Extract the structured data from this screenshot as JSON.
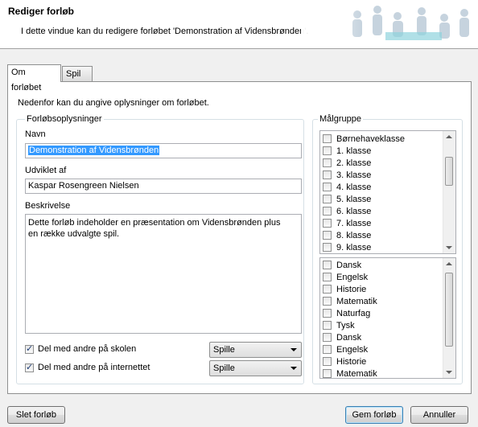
{
  "header": {
    "title": "Rediger forløb",
    "subtitle": "I dette vindue kan du redigere forløbet 'Demonstration af Vidensbrønden'."
  },
  "tabs": [
    {
      "label": "Om forløbet",
      "active": true
    },
    {
      "label": "Spil",
      "active": false
    }
  ],
  "intro": "Nedenfor kan du angive oplysninger om forløbet.",
  "details": {
    "legend": "Forløbsoplysninger",
    "name_label": "Navn",
    "name_value": "Demonstration af Vidensbrønden",
    "author_label": "Udviklet af",
    "author_value": "Kaspar Rosengreen Nielsen",
    "description_label": "Beskrivelse",
    "description_value": "Dette forløb indeholder en præsentation om Vidensbrønden plus en række udvalgte spil.",
    "share_school_label": "Del med andre på skolen",
    "share_school_checked": true,
    "share_school_mode": "Spille",
    "share_internet_label": "Del med andre på internettet",
    "share_internet_checked": true,
    "share_internet_mode": "Spille"
  },
  "target_group": {
    "legend": "Målgruppe",
    "grades": [
      "Børnehaveklasse",
      "1. klasse",
      "2. klasse",
      "3. klasse",
      "4. klasse",
      "5. klasse",
      "6. klasse",
      "7. klasse",
      "8. klasse",
      "9. klasse"
    ],
    "subjects": [
      "Dansk",
      "Engelsk",
      "Historie",
      "Matematik",
      "Naturfag",
      "Tysk",
      "Dansk",
      "Engelsk",
      "Historie",
      "Matematik"
    ]
  },
  "buttons": {
    "delete": "Slet forløb",
    "save": "Gem forløb",
    "cancel": "Annuller"
  }
}
